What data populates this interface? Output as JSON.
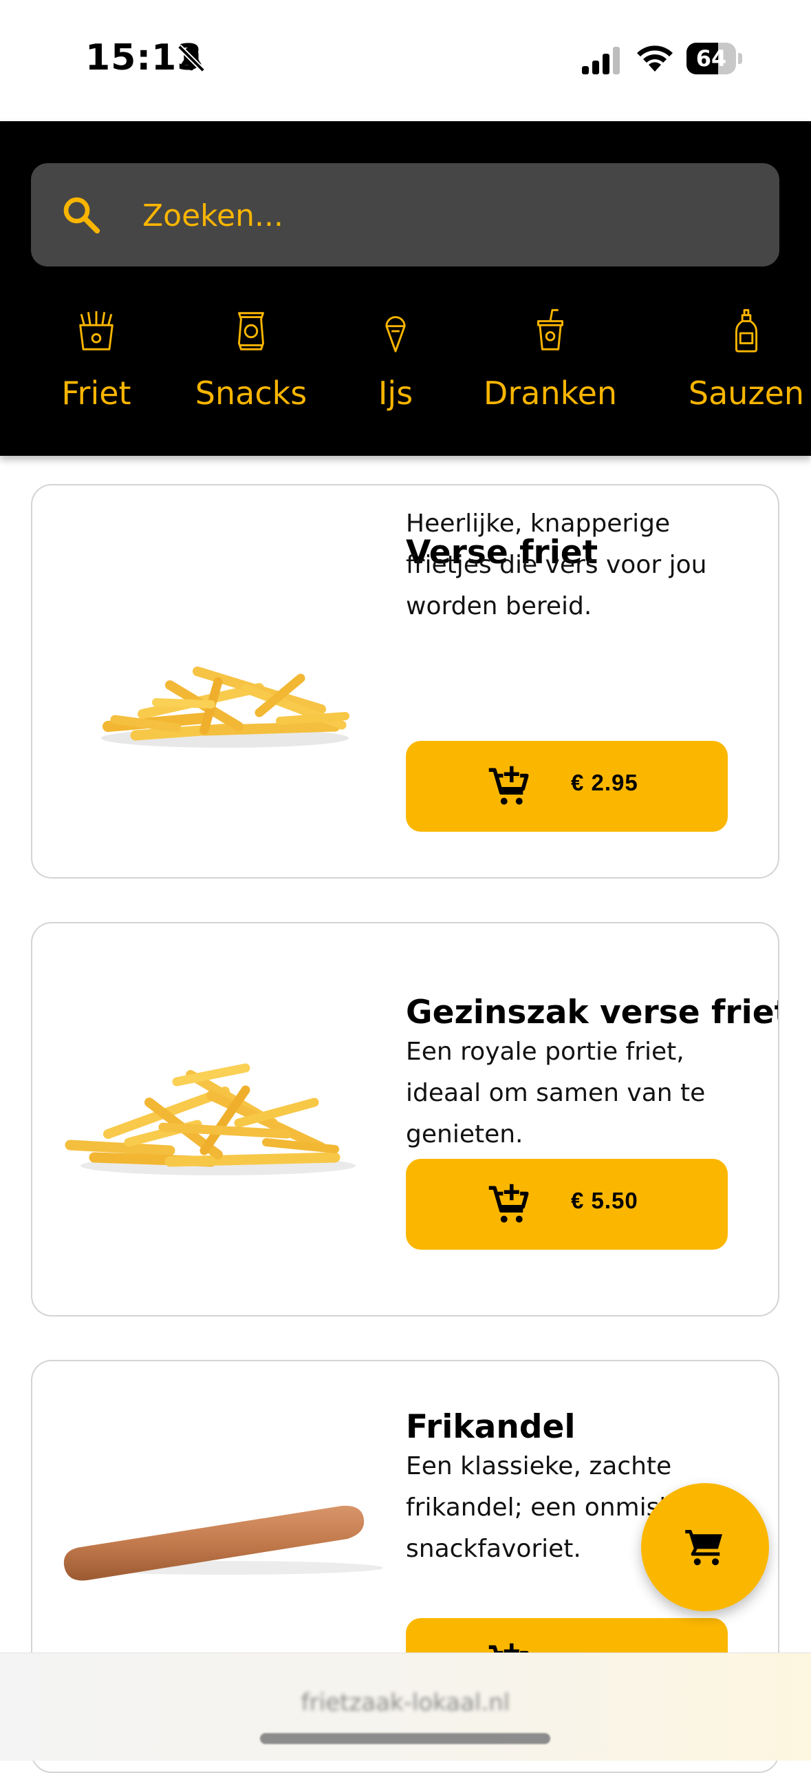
{
  "status_bar": {
    "time": "15:13",
    "battery": "64",
    "battery_level": 0.64
  },
  "search": {
    "placeholder": "Zoeken..."
  },
  "categories": [
    {
      "label": "Friet",
      "icon": "fries-icon"
    },
    {
      "label": "Snacks",
      "icon": "chips-bag-icon"
    },
    {
      "label": "Ijs",
      "icon": "ice-cream-icon"
    },
    {
      "label": "Dranken",
      "icon": "drink-cup-icon"
    },
    {
      "label": "Sauzen",
      "icon": "sauce-bottle-icon"
    }
  ],
  "products": [
    {
      "title": "Verse friet",
      "description": "Heerlijke, knapperige frietjes die vers voor jou worden bereid.",
      "price": "€ 2.95",
      "image": "fries-image"
    },
    {
      "title": "Gezinszak verse friet",
      "description": "Een royale portie friet, ideaal om samen van te genieten.",
      "price": "€ 5.50",
      "image": "fries-pile-image"
    },
    {
      "title": "Frikandel",
      "description": "Een klassieke, zachte frikandel; een onmisbare snackfavoriet.",
      "price": "",
      "image": "frikandel-image"
    }
  ],
  "browser": {
    "url": "frietzaak-lokaal.nl"
  },
  "colors": {
    "accent": "#fbb700",
    "header_bg": "#000000",
    "search_bg": "#464646"
  }
}
